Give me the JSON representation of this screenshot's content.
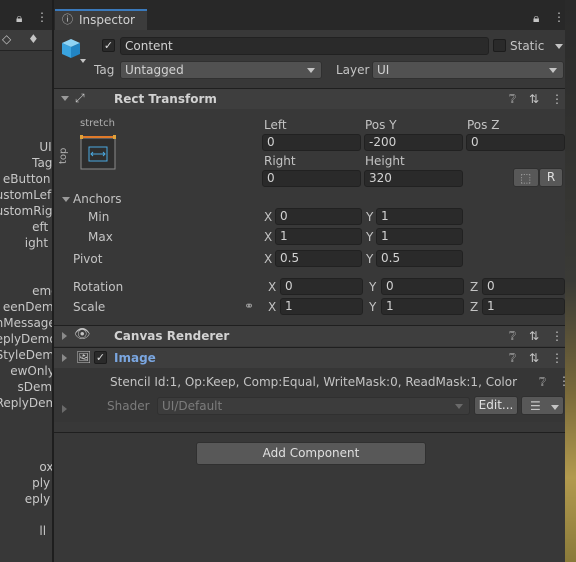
{
  "hierarchy": {
    "items": [
      "UI",
      "Tag",
      "eButton",
      "ustomLef",
      "ustomRig",
      "eft",
      "ight",
      "emo",
      "eenDemo",
      "nMessage",
      "eplyDemo",
      "StyleDem",
      "ewOnly",
      "sDemo",
      "ReplyDem",
      "ox",
      "ply",
      "eply",
      "ll"
    ]
  },
  "inspector": {
    "tab_label": "Inspector",
    "object": {
      "name": "Content",
      "static_label": "Static",
      "tag_label": "Tag",
      "tag_value": "Untagged",
      "layer_label": "Layer",
      "layer_value": "UI"
    },
    "rect_transform": {
      "title": "Rect Transform",
      "anchor_preset_h": "stretch",
      "anchor_preset_v": "top",
      "left_label": "Left",
      "left_value": "0",
      "posy_label": "Pos Y",
      "posy_value": "-200",
      "posz_label": "Pos Z",
      "posz_value": "0",
      "right_label": "Right",
      "right_value": "0",
      "height_label": "Height",
      "height_value": "320",
      "r_button": "R",
      "anchors_label": "Anchors",
      "min_label": "Min",
      "min_x": "0",
      "min_y": "1",
      "max_label": "Max",
      "max_x": "1",
      "max_y": "1",
      "pivot_label": "Pivot",
      "pivot_x": "0.5",
      "pivot_y": "0.5",
      "rotation_label": "Rotation",
      "rot_x": "0",
      "rot_y": "0",
      "rot_z": "0",
      "scale_label": "Scale",
      "scale_x": "1",
      "scale_y": "1",
      "scale_z": "1",
      "x": "X",
      "y": "Y",
      "z": "Z"
    },
    "canvas_renderer": {
      "title": "Canvas Renderer"
    },
    "image": {
      "title": "Image",
      "stencil_text": "Stencil Id:1, Op:Keep, Comp:Equal, WriteMask:0, ReadMask:1, Color",
      "shader_label": "Shader",
      "shader_value": "UI/Default",
      "edit_button": "Edit..."
    },
    "add_component": "Add Component"
  },
  "colors": {
    "accent": "#3a79bb",
    "image_title": "#7aa6e0",
    "background": "#383838"
  }
}
